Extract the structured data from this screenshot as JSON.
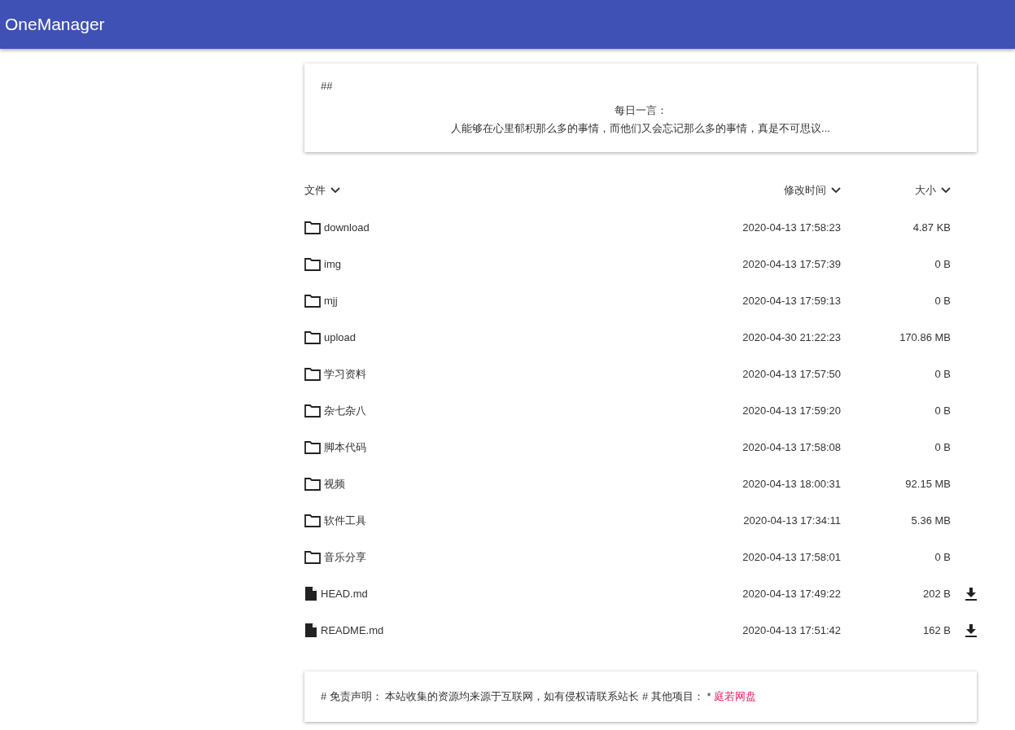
{
  "app_bar": {
    "title": "OneManager"
  },
  "head_card": {
    "heading": "##",
    "lines": [
      "每日一言：",
      "人能够在心里郁积那么多的事情，而他们又会忘记那么多的事情，真是不可思议..."
    ]
  },
  "table": {
    "columns": [
      {
        "label": "文件"
      },
      {
        "label": "修改时间"
      },
      {
        "label": "大小"
      }
    ],
    "rows": [
      {
        "kind": "folder",
        "name": "download",
        "modified": "2020-04-13 17:58:23",
        "size": "4.87 KB"
      },
      {
        "kind": "folder",
        "name": "img",
        "modified": "2020-04-13 17:57:39",
        "size": "0 B"
      },
      {
        "kind": "folder",
        "name": "mjj",
        "modified": "2020-04-13 17:59:13",
        "size": "0 B"
      },
      {
        "kind": "folder",
        "name": "upload",
        "modified": "2020-04-30 21:22:23",
        "size": "170.86 MB"
      },
      {
        "kind": "folder",
        "name": "学习资料",
        "modified": "2020-04-13 17:57:50",
        "size": "0 B"
      },
      {
        "kind": "folder",
        "name": "杂七杂八",
        "modified": "2020-04-13 17:59:20",
        "size": "0 B"
      },
      {
        "kind": "folder",
        "name": "脚本代码",
        "modified": "2020-04-13 17:58:08",
        "size": "0 B"
      },
      {
        "kind": "folder",
        "name": "视频",
        "modified": "2020-04-13 18:00:31",
        "size": "92.15 MB"
      },
      {
        "kind": "folder",
        "name": "软件工具",
        "modified": "2020-04-13 17:34:11",
        "size": "5.36 MB"
      },
      {
        "kind": "folder",
        "name": "音乐分享",
        "modified": "2020-04-13 17:58:01",
        "size": "0 B"
      },
      {
        "kind": "file",
        "name": "HEAD.md",
        "modified": "2020-04-13 17:49:22",
        "size": "202 B"
      },
      {
        "kind": "file",
        "name": "README.md",
        "modified": "2020-04-13 17:51:42",
        "size": "162 B"
      }
    ]
  },
  "footer_card": {
    "text": "# 免责声明： 本站收集的资源均来源于互联网，如有侵权请联系站长 # 其他项目： * ",
    "link": "庭若网盘"
  }
}
